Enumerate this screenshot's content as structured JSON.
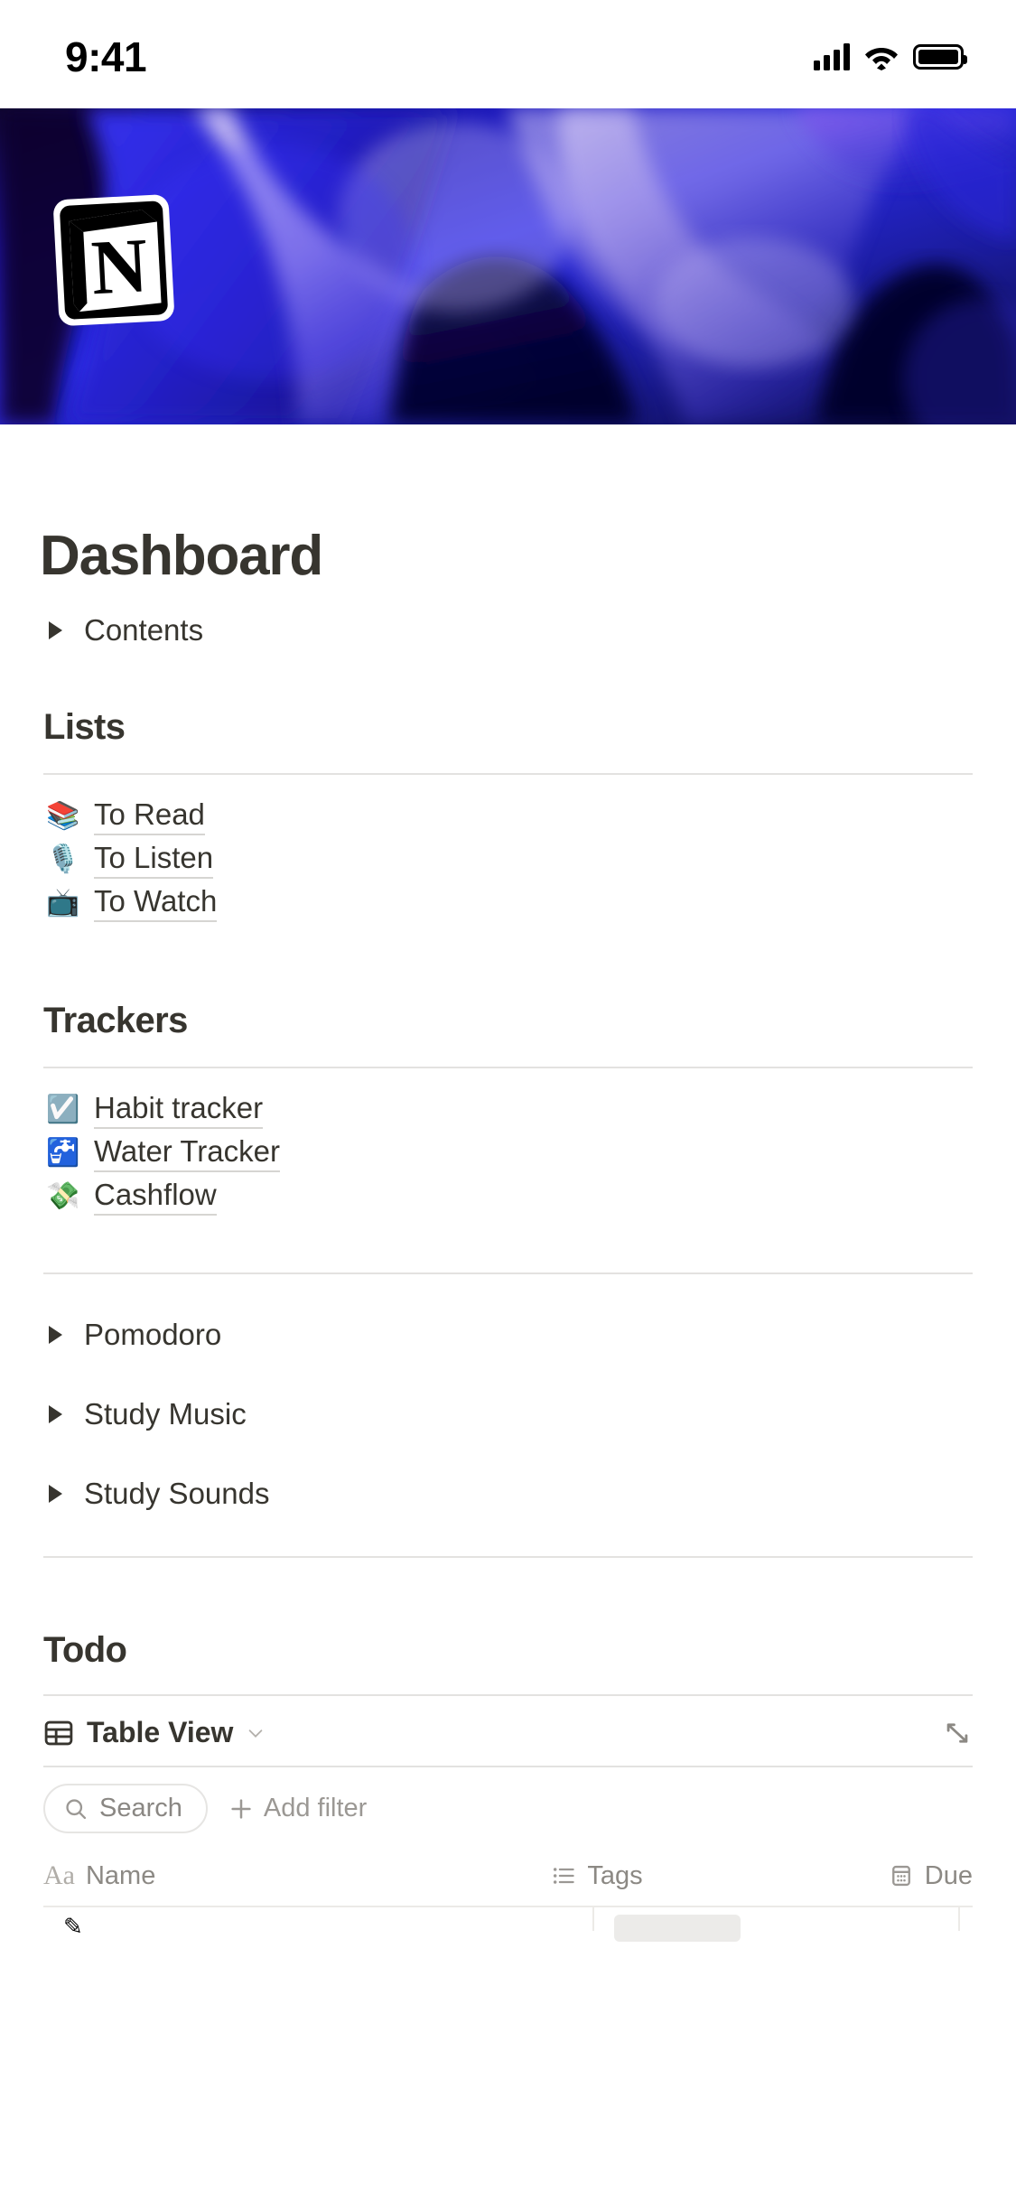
{
  "status_bar": {
    "time": "9:41",
    "icons": [
      "cellular-signal-icon",
      "wifi-icon",
      "battery-icon"
    ]
  },
  "page": {
    "title": "Dashboard",
    "icon": "notion-logo-icon",
    "cover": "abstract-blue-purple-wave-gradient"
  },
  "contents_toggle": {
    "label": "Contents"
  },
  "sections": [
    {
      "heading": "Lists",
      "items": [
        {
          "emoji": "📚",
          "emoji_name": "books-emoji",
          "label": "To Read"
        },
        {
          "emoji": "🎙️",
          "emoji_name": "studio-microphone-emoji",
          "label": "To Listen"
        },
        {
          "emoji": "📺",
          "emoji_name": "television-emoji",
          "label": "To Watch"
        }
      ]
    },
    {
      "heading": "Trackers",
      "items": [
        {
          "emoji": "☑️",
          "emoji_name": "checkbox-emoji",
          "label": "Habit tracker"
        },
        {
          "emoji": "🚰",
          "emoji_name": "potable-water-emoji",
          "label": "Water Tracker"
        },
        {
          "emoji": "💸",
          "emoji_name": "money-with-wings-emoji",
          "label": "Cashflow"
        }
      ]
    }
  ],
  "toggles": [
    {
      "label": "Pomodoro"
    },
    {
      "label": "Study Music"
    },
    {
      "label": "Study Sounds"
    }
  ],
  "todo": {
    "heading": "Todo",
    "view_tab": {
      "label": "Table View",
      "icon": "table-grid-icon",
      "chevron": "chevron-down-icon"
    },
    "expand_icon": "expand-diagonal-icon",
    "toolbar": {
      "search_label": "Search",
      "search_icon": "search-icon",
      "add_filter_label": "Add filter",
      "add_filter_icon": "plus-icon"
    },
    "columns": [
      {
        "type_icon": "Aa",
        "type_icon_name": "text-type-icon",
        "label": "Name"
      },
      {
        "type_icon": "list",
        "type_icon_name": "multiselect-type-icon",
        "label": "Tags"
      },
      {
        "type_icon": "calendar",
        "type_icon_name": "date-type-icon",
        "label": "Due"
      }
    ]
  },
  "colors": {
    "text": "#37352f",
    "muted": "#8c8984",
    "divider": "#e3e2e0",
    "cover_deep_navy": "#0a0838",
    "cover_blue": "#2222dd",
    "cover_lavender": "#c0b2ec"
  }
}
